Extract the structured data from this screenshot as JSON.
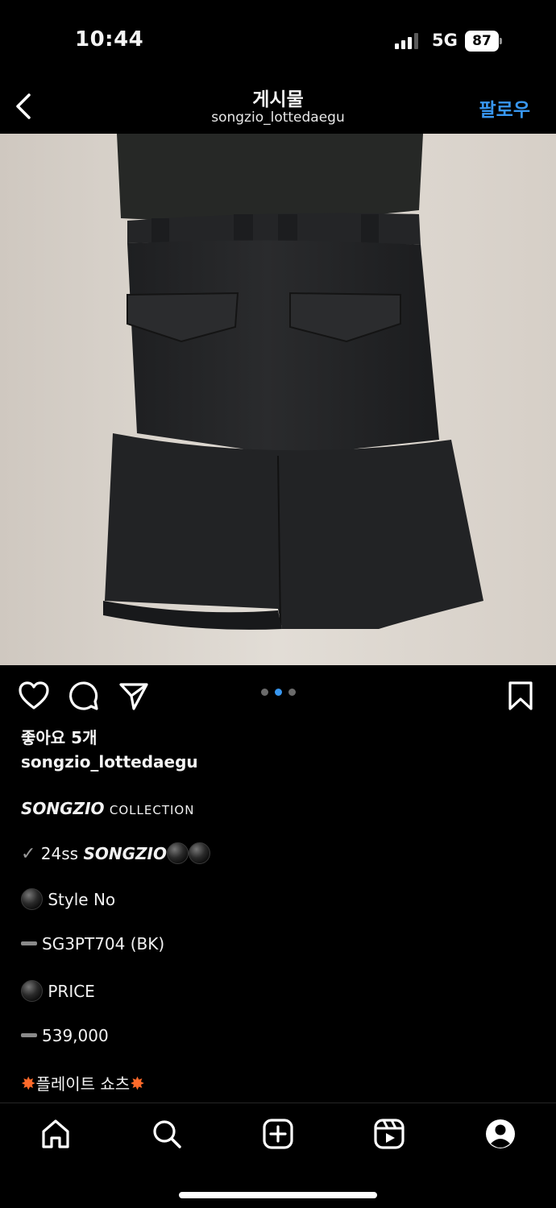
{
  "status_bar": {
    "time": "10:44",
    "network": "5G",
    "battery": "87"
  },
  "header": {
    "title": "게시물",
    "subtitle": "songzio_lottedaegu",
    "follow_label": "팔로우"
  },
  "post": {
    "likes": "좋아요 5개",
    "username": "songzio_lottedaegu",
    "carousel": {
      "count": 3,
      "active_index": 1
    },
    "caption": {
      "line1_brand": "SONGZIO",
      "line1_rest": "COLLECTION",
      "line2_prefix": "24ss",
      "line2_brand": "SONGZIO",
      "line3": "Style No",
      "line4": "SG3PT704 (BK)",
      "line5": "PRICE",
      "line6": "539,000",
      "line7": "플레이트 쇼츠"
    }
  },
  "colors": {
    "accent": "#3897f0",
    "background": "#000000"
  },
  "icons": {
    "actions": [
      "heart-icon",
      "comment-icon",
      "share-icon",
      "bookmark-icon"
    ],
    "nav": [
      "home-icon",
      "search-icon",
      "create-icon",
      "reels-icon",
      "profile-icon"
    ]
  }
}
